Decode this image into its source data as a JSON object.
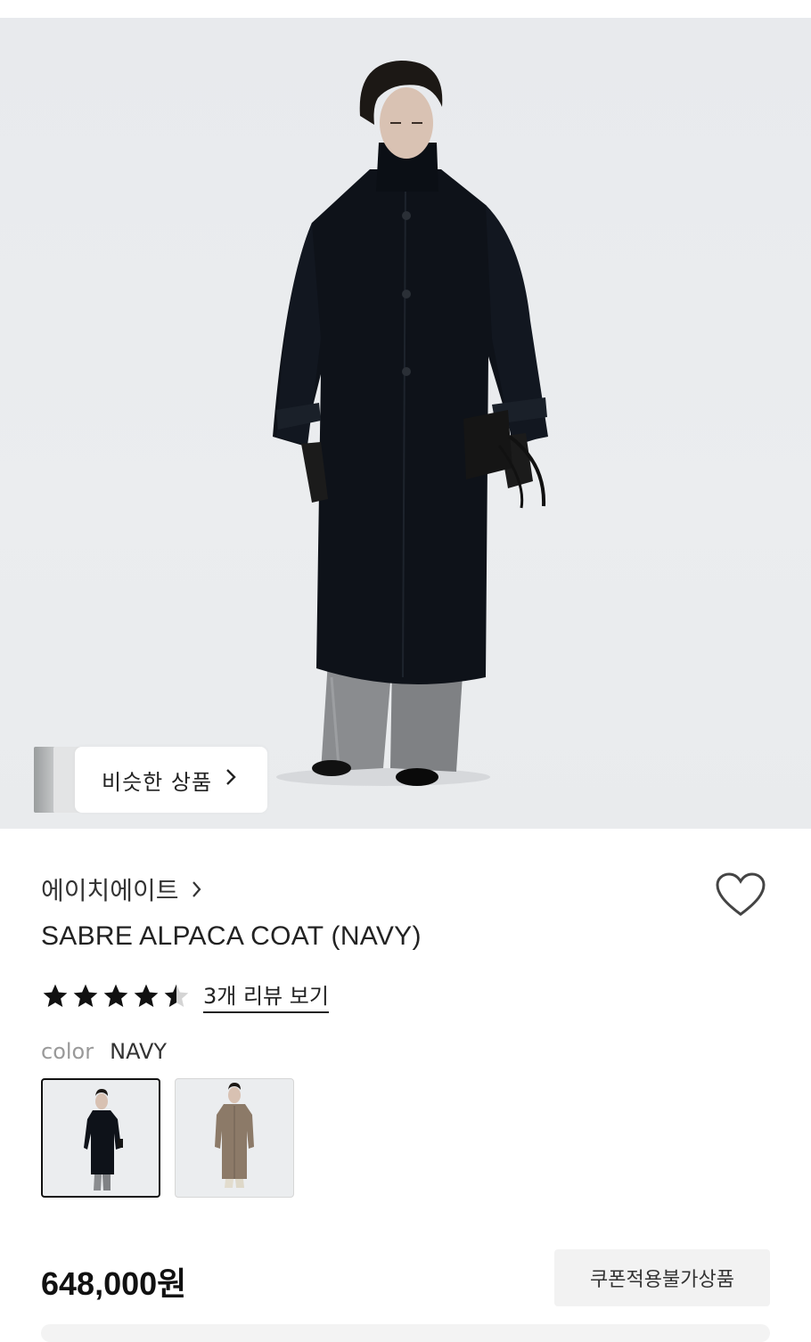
{
  "similar_button": {
    "label": "비슷한 상품"
  },
  "brand": {
    "name": "에이치에이트"
  },
  "product": {
    "title": "SABRE ALPACA COAT (NAVY)",
    "rating": 4.5,
    "review_link": "3개 리뷰 보기",
    "color_label": "color",
    "color_value": "NAVY",
    "color_options": [
      "navy",
      "beige"
    ],
    "price": "648,000원",
    "coupon_badge": "쿠폰적용불가상품"
  },
  "colors": {
    "coat_navy": "#0e1219",
    "coat_beige": "#8c7a68",
    "pants_grey": "#8a8c8f",
    "background": "#e9ebed"
  },
  "icons": [
    "chevron-right-icon",
    "heart-icon",
    "star-icon"
  ]
}
